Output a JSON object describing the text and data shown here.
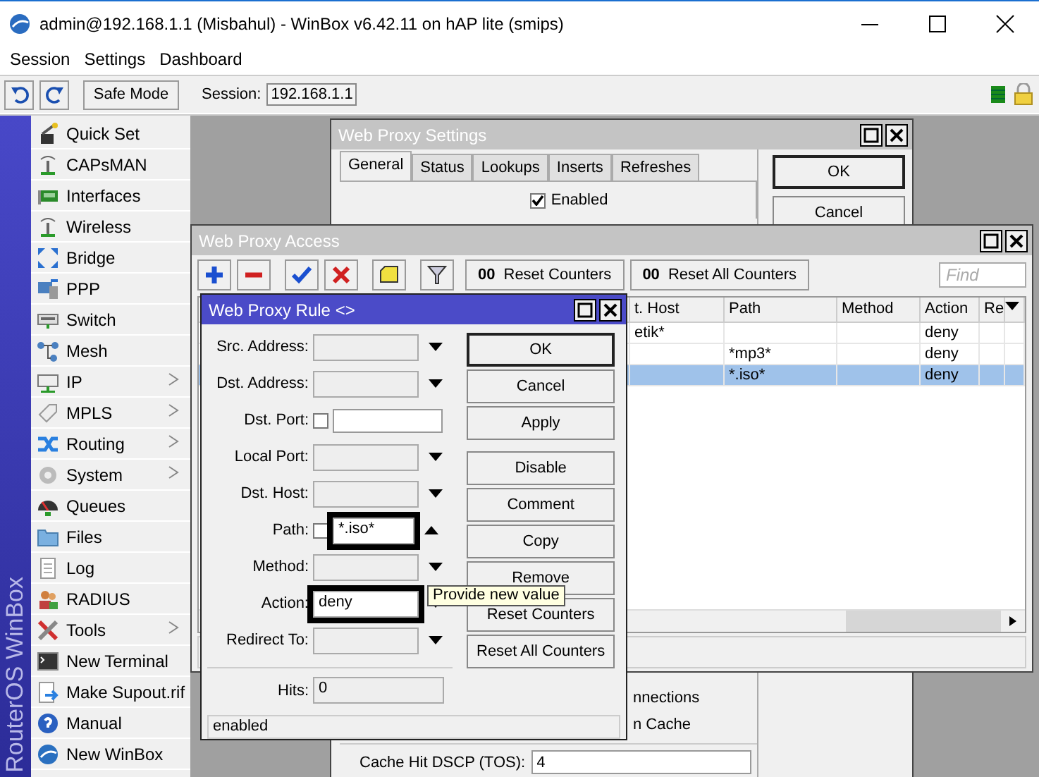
{
  "window": {
    "title": "admin@192.168.1.1 (Misbahul) - WinBox v6.42.11 on hAP lite (smips)"
  },
  "menu": [
    "Session",
    "Settings",
    "Dashboard"
  ],
  "toolbar": {
    "safe_mode": "Safe Mode",
    "session_label": "Session:",
    "session": "192.168.1.1"
  },
  "sidebar": {
    "brand": "RouterOS WinBox",
    "items": [
      {
        "label": "Quick Set",
        "submenu": false
      },
      {
        "label": "CAPsMAN",
        "submenu": false
      },
      {
        "label": "Interfaces",
        "submenu": false
      },
      {
        "label": "Wireless",
        "submenu": false
      },
      {
        "label": "Bridge",
        "submenu": false
      },
      {
        "label": "PPP",
        "submenu": false
      },
      {
        "label": "Switch",
        "submenu": false
      },
      {
        "label": "Mesh",
        "submenu": false
      },
      {
        "label": "IP",
        "submenu": true
      },
      {
        "label": "MPLS",
        "submenu": true
      },
      {
        "label": "Routing",
        "submenu": true
      },
      {
        "label": "System",
        "submenu": true
      },
      {
        "label": "Queues",
        "submenu": false
      },
      {
        "label": "Files",
        "submenu": false
      },
      {
        "label": "Log",
        "submenu": false
      },
      {
        "label": "RADIUS",
        "submenu": false
      },
      {
        "label": "Tools",
        "submenu": true
      },
      {
        "label": "New Terminal",
        "submenu": false
      },
      {
        "label": "Make Supout.rif",
        "submenu": false
      },
      {
        "label": "Manual",
        "submenu": false
      },
      {
        "label": "New WinBox",
        "submenu": false
      }
    ]
  },
  "proxy_settings": {
    "title": "Web Proxy Settings",
    "tabs": [
      {
        "label": "General",
        "selected": true
      },
      {
        "label": "Status",
        "selected": false
      },
      {
        "label": "Lookups",
        "selected": false
      },
      {
        "label": "Inserts",
        "selected": false
      },
      {
        "label": "Refreshes",
        "selected": false
      }
    ],
    "enabled": {
      "label": "Enabled",
      "checked": true
    },
    "fragments": [
      "nnections",
      "n Cache"
    ],
    "dscp": {
      "label": "Cache Hit DSCP (TOS):",
      "value": "4"
    },
    "buttons": [
      "OK",
      "Cancel"
    ]
  },
  "proxy_access": {
    "title": "Web Proxy Access",
    "counter_buttons": [
      {
        "icon": "00",
        "label": "Reset Counters"
      },
      {
        "icon": "00",
        "label": "Reset All Counters"
      }
    ],
    "find": {
      "placeholder": "Find"
    },
    "columns": [
      "t. Host",
      "Path",
      "Method",
      "Action",
      "Re"
    ],
    "rows": [
      {
        "dst_host": "etik*",
        "action": "deny",
        "selected": false
      },
      {
        "path": "*mp3*",
        "action": "deny",
        "selected": false
      },
      {
        "path": "*.iso*",
        "action": "deny",
        "selected": true
      }
    ]
  },
  "rule_dialog": {
    "title": "Web Proxy Rule <>",
    "fields": [
      {
        "label": "Src. Address:",
        "kind": "combo",
        "highlighted": false
      },
      {
        "label": "Dst. Address:",
        "kind": "combo",
        "highlighted": false
      },
      {
        "label": "Dst. Port:",
        "kind": "check-text",
        "checked": false,
        "highlighted": false
      },
      {
        "label": "Local Port:",
        "kind": "combo",
        "highlighted": false
      },
      {
        "label": "Dst. Host:",
        "kind": "combo",
        "highlighted": false
      },
      {
        "label": "Path:",
        "kind": "check-combo",
        "checked": false,
        "value": "*.iso*",
        "highlighted": true
      },
      {
        "label": "Method:",
        "kind": "combo",
        "highlighted": false
      },
      {
        "label": "Action:",
        "kind": "combo",
        "value": "deny",
        "highlighted": true
      },
      {
        "label": "Redirect To:",
        "kind": "combo",
        "highlighted": false
      }
    ],
    "hits": {
      "label": "Hits:",
      "value": "0"
    },
    "status": "enabled",
    "buttons": [
      {
        "label": "OK",
        "default": true
      },
      {
        "label": "Cancel",
        "default": false
      },
      {
        "label": "Apply",
        "default": false
      },
      {
        "label": "Disable",
        "default": false
      },
      {
        "label": "Comment",
        "default": false
      },
      {
        "label": "Copy",
        "default": false
      },
      {
        "label": "Remove",
        "default": false
      },
      {
        "label": "Reset Counters",
        "default": false
      },
      {
        "label": "Reset All Counters",
        "default": false
      }
    ],
    "tooltip": "Provide new value"
  }
}
